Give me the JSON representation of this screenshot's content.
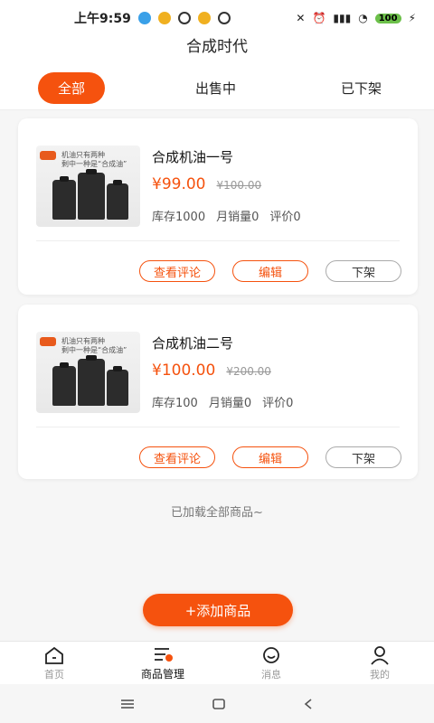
{
  "status_bar": {
    "time": "上午9:59",
    "battery": "100"
  },
  "page_title": "合成时代",
  "tabs": [
    {
      "label": "全部",
      "active": true
    },
    {
      "label": "出售中",
      "active": false
    },
    {
      "label": "已下架",
      "active": false
    }
  ],
  "products": [
    {
      "name": "合成机油一号",
      "price": "¥99.00",
      "old_price": "¥100.00",
      "stock": "库存1000",
      "monthly_sales": "月销量0",
      "reviews": "评价0",
      "image_lines": [
        "机油只有两种",
        "剩中一种是“合成油”"
      ]
    },
    {
      "name": "合成机油二号",
      "price": "¥100.00",
      "old_price": "¥200.00",
      "stock": "库存100",
      "monthly_sales": "月销量0",
      "reviews": "评价0",
      "image_lines": [
        "机油只有两种",
        "剩中一种是“合成油”"
      ]
    }
  ],
  "buttons": {
    "review": "查看评论",
    "edit": "编辑",
    "delist": "下架"
  },
  "loaded_tip": "已加载全部商品~",
  "add_button": "+添加商品",
  "tabbar": [
    {
      "label": "首页",
      "icon": "home-icon",
      "active": false
    },
    {
      "label": "商品管理",
      "icon": "goods-list-icon",
      "active": true
    },
    {
      "label": "消息",
      "icon": "message-icon",
      "active": false
    },
    {
      "label": "我的",
      "icon": "user-icon",
      "active": false
    }
  ],
  "colors": {
    "accent": "#f5520e"
  }
}
